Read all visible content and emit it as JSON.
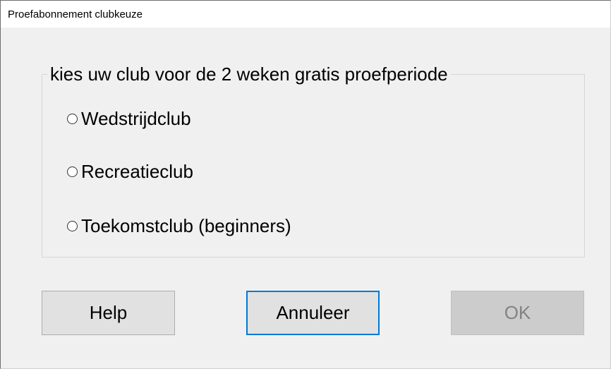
{
  "window": {
    "title": "Proefabonnement clubkeuze"
  },
  "group": {
    "legend": "kies uw club voor de 2 weken gratis proefperiode",
    "options": [
      {
        "label": "Wedstrijdclub",
        "selected": false
      },
      {
        "label": "Recreatieclub",
        "selected": false
      },
      {
        "label": "Toekomstclub (beginners)",
        "selected": false
      }
    ]
  },
  "buttons": {
    "help": "Help",
    "cancel": "Annuleer",
    "ok": "OK",
    "ok_enabled": false,
    "default_button": "cancel"
  },
  "colors": {
    "dialog_background": "#f0f0f0",
    "focus_border": "#0078d7",
    "disabled_text": "#838383"
  }
}
